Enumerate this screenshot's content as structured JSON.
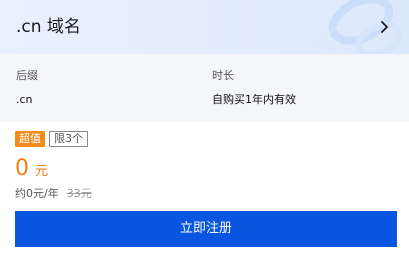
{
  "header": {
    "title": ".cn 域名",
    "chevron_icon": "chevron-right-icon"
  },
  "info": {
    "suffix_label": "后缀",
    "suffix_value": ".cn",
    "duration_label": "时长",
    "duration_value": "自购买1年内有效"
  },
  "tags": {
    "hot": "超值",
    "limit": "限3个"
  },
  "price": {
    "amount": "0",
    "unit": "元",
    "per_year": "约0元/年",
    "original": "33元"
  },
  "actions": {
    "register_label": "立即注册"
  },
  "colors": {
    "accent": "#0a55e0",
    "price": "#f08214",
    "hot_tag": "#f28a1c"
  }
}
